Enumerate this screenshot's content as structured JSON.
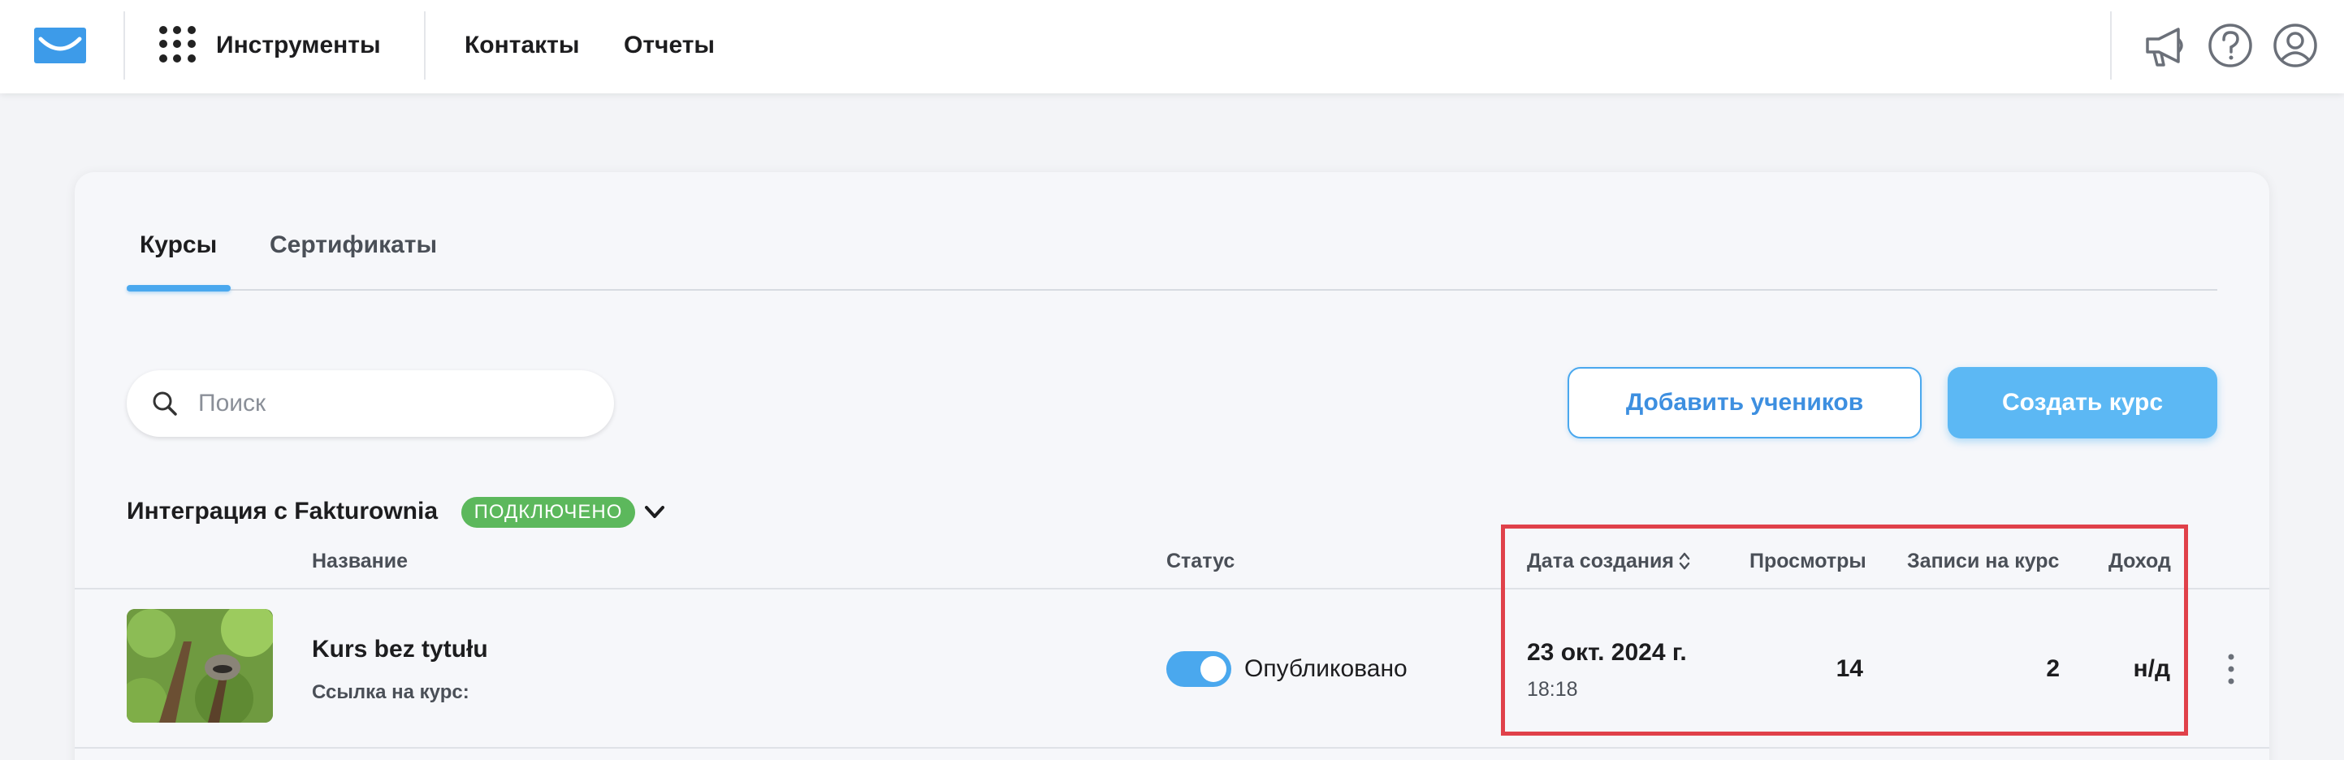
{
  "header": {
    "tools_label": "Инструменты",
    "nav_contacts": "Контакты",
    "nav_reports": "Отчеты",
    "icons": [
      "mail-logo-icon",
      "apps-grid-icon",
      "megaphone-icon",
      "help-icon",
      "account-icon"
    ]
  },
  "tabs": [
    {
      "label": "Курсы",
      "active": true
    },
    {
      "label": "Сертификаты",
      "active": false
    }
  ],
  "search": {
    "placeholder": "Поиск",
    "value": ""
  },
  "actions": {
    "add_students": "Добавить учеников",
    "create_course": "Создать курс"
  },
  "integration": {
    "title": "Интеграция с Fakturownia",
    "badge": "ПОДКЛЮЧЕНО"
  },
  "table": {
    "headers": {
      "name": "Название",
      "status": "Статус",
      "created": "Дата создания",
      "views": "Просмотры",
      "enrollments": "Записи на курс",
      "revenue": "Доход"
    },
    "rows": [
      {
        "name": "Kurs bez tytułu",
        "link_label": "Ссылка на курс:",
        "status": "Опубликовано",
        "published": true,
        "created_date": "23 окт. 2024 г.",
        "created_time": "18:18",
        "views": "14",
        "enrollments": "2",
        "revenue": "н/д"
      }
    ]
  },
  "colors": {
    "accent": "#4aa8ee",
    "primary_button": "#5cb8f4",
    "badge_green": "#5cb85c",
    "highlight_red": "#e0414a"
  }
}
